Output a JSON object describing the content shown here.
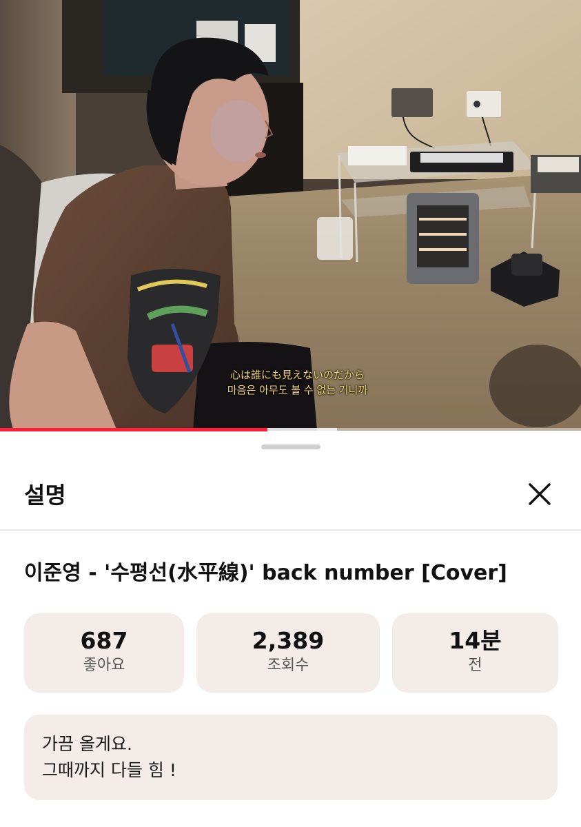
{
  "video": {
    "subtitle_ja": "心は誰にも見えないのだから",
    "subtitle_ko": "마음은 아무도 볼 수 없는 거니까",
    "progress_fraction": 0.46,
    "buffered_fraction": 0.58,
    "progress_color": "#ff1f3d"
  },
  "sheet": {
    "title": "설명",
    "close_icon": "close-icon"
  },
  "video_info": {
    "title": "이준영 - '수평선(水平線)' back number [Cover]"
  },
  "stats": [
    {
      "value": "687",
      "label": "좋아요"
    },
    {
      "value": "2,389",
      "label": "조회수"
    },
    {
      "value": "14분",
      "label": "전"
    }
  ],
  "description": {
    "lines": [
      "가끔 올게요.",
      "그때까지 다들 힘 !"
    ]
  },
  "colors": {
    "card_background": "#f3ece8"
  }
}
